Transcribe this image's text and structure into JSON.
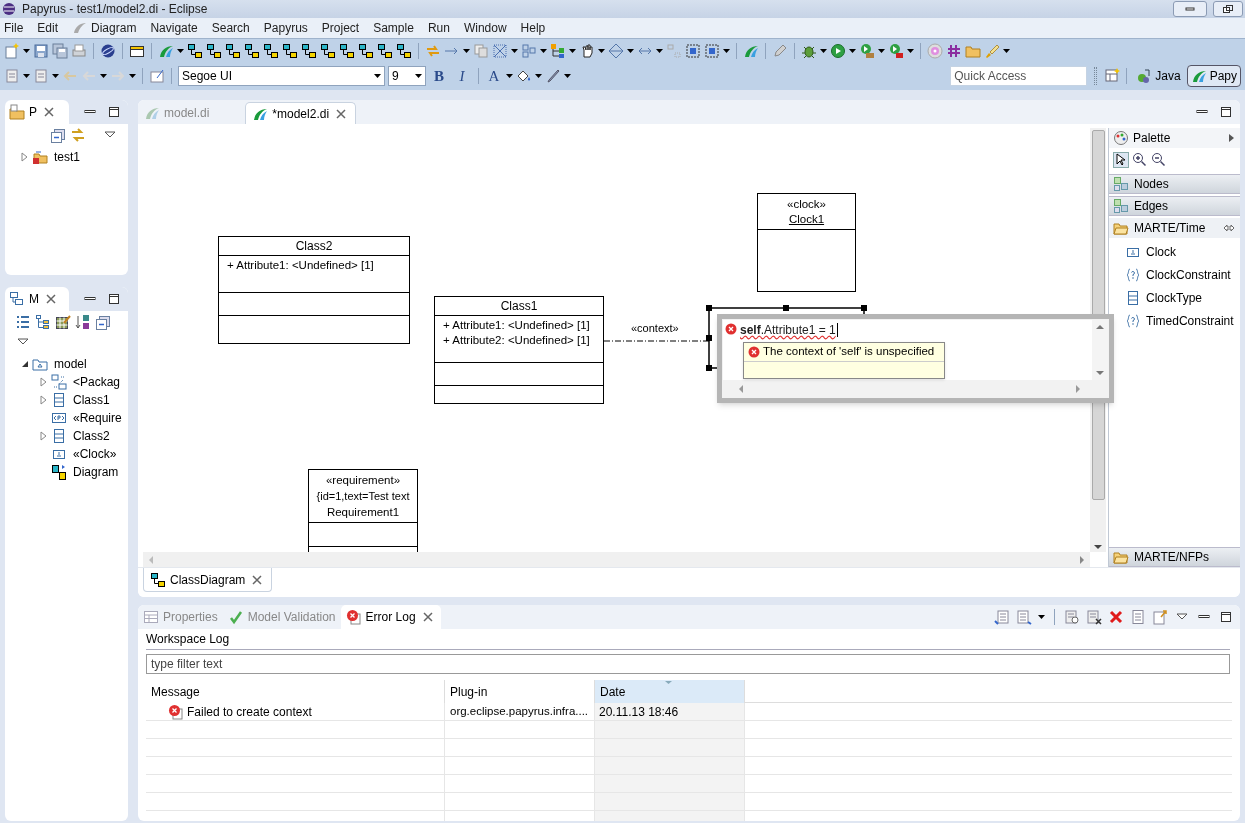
{
  "window": {
    "title": "Papyrus - test1/model2.di - Eclipse"
  },
  "menu": [
    "File",
    "Edit",
    "Diagram",
    "Navigate",
    "Search",
    "Papyrus",
    "Project",
    "Sample",
    "Run",
    "Window",
    "Help"
  ],
  "toolbar": {
    "font": "Segoe UI",
    "size": "9",
    "format_buttons": [
      "B",
      "I",
      "A"
    ],
    "quick_access": {
      "placeholder": "Quick Access"
    },
    "perspectives": [
      {
        "label": "Java",
        "selected": false
      },
      {
        "label": "Papy",
        "selected": true
      }
    ]
  },
  "project_explorer": {
    "tab": "P",
    "tree": [
      {
        "label": "test1",
        "kind": "project",
        "expanded": false
      }
    ]
  },
  "model_explorer": {
    "tab": "M",
    "tree": [
      {
        "label": "model",
        "kind": "model",
        "expanded": true,
        "children": [
          {
            "label": "<Packag",
            "kind": "import",
            "expanded": false
          },
          {
            "label": "Class1",
            "kind": "class",
            "expanded": false
          },
          {
            "label": "«Require",
            "kind": "requirement"
          },
          {
            "label": "Class2",
            "kind": "class",
            "expanded": false
          },
          {
            "label": "«Clock»",
            "kind": "clock"
          },
          {
            "label": "Diagram",
            "kind": "diagram"
          }
        ]
      }
    ]
  },
  "editor": {
    "tabs": [
      {
        "label": "model.di",
        "selected": false
      },
      {
        "label": "*model2.di",
        "selected": true
      }
    ],
    "nodes": [
      {
        "kind": "class",
        "name": "Class2",
        "attributes": [
          "+ Attribute1: <Undefined> [1]"
        ]
      },
      {
        "kind": "class",
        "name": "Class1",
        "attributes": [
          "+ Attribute1: <Undefined> [1]",
          "+ Attribute2: <Undefined> [1]"
        ]
      },
      {
        "kind": "clock",
        "stereotype": "«clock»",
        "name": "Clock1"
      },
      {
        "kind": "requirement",
        "stereotype": "«requirement»",
        "properties": "{id=1,text=Test text",
        "name": "Requirement1"
      }
    ],
    "edge": {
      "label": "«context»"
    },
    "constraint_editor": {
      "text": "**self**.Attribute1 = 1",
      "error": "The context of 'self' is unspecified"
    },
    "palette": {
      "title": "Palette",
      "drawers": [
        {
          "label": "Nodes",
          "expanded": false
        },
        {
          "label": "Edges",
          "expanded": false
        },
        {
          "label": "MARTE/Time",
          "expanded": true,
          "items": [
            {
              "label": "Clock",
              "kind": "clock"
            },
            {
              "label": "ClockConstraint",
              "kind": "constraint"
            },
            {
              "label": "ClockType",
              "kind": "class"
            },
            {
              "label": "TimedConstraint",
              "kind": "constraint"
            }
          ]
        },
        {
          "label": "MARTE/NFPs",
          "expanded": false
        }
      ]
    },
    "diagram_tabs": [
      {
        "label": "ClassDiagram",
        "selected": true
      }
    ]
  },
  "bottom_panel": {
    "tabs": [
      {
        "label": "Properties",
        "kind": "properties",
        "selected": false
      },
      {
        "label": "Model Validation",
        "kind": "validation",
        "selected": false
      },
      {
        "label": "Error Log",
        "kind": "errorlog",
        "selected": true
      }
    ],
    "log_title": "Workspace Log",
    "filter": {
      "placeholder": "type filter text"
    },
    "columns": [
      "Message",
      "Plug-in",
      "Date"
    ],
    "rows": [
      {
        "message": "Failed to create context",
        "plugin": "org.eclipse.papyrus.infra....",
        "date": "20.11.13 18:46"
      }
    ]
  }
}
